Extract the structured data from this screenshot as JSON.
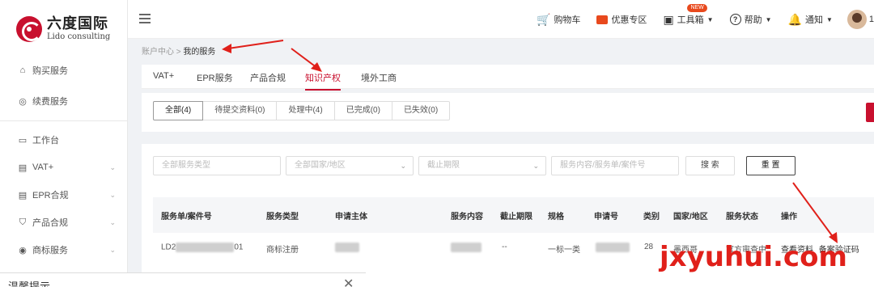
{
  "brand": {
    "name_cn": "六度国际",
    "name_en": "Lido consulting"
  },
  "sidebar": {
    "items": [
      {
        "icon": "shopping-bag-icon",
        "glyph": "⌂",
        "label": "购买服务",
        "chevron": false
      },
      {
        "icon": "renew-icon",
        "glyph": "◎",
        "label": "续费服务",
        "chevron": false
      },
      {
        "icon": "monitor-icon",
        "glyph": "▭",
        "label": "工作台",
        "chevron": false
      },
      {
        "icon": "vat-icon",
        "glyph": "▤",
        "label": "VAT+",
        "chevron": true
      },
      {
        "icon": "epr-icon",
        "glyph": "▤",
        "label": "EPR合规",
        "chevron": true
      },
      {
        "icon": "shield-icon",
        "glyph": "⛉",
        "label": "产品合规",
        "chevron": true
      },
      {
        "icon": "trademark-icon",
        "glyph": "◉",
        "label": "商标服务",
        "chevron": true
      }
    ]
  },
  "header": {
    "cart": "购物车",
    "coupon": "优惠专区",
    "toolbox": "工具箱",
    "toolbox_badge": "NEW",
    "help": "帮助",
    "notify": "通知",
    "user_initial": "1"
  },
  "breadcrumb": {
    "root": "账户中心",
    "sep": ">",
    "current": "我的服务"
  },
  "service_tabs": [
    "VAT+",
    "EPR服务",
    "产品合规",
    "知识产权",
    "境外工商"
  ],
  "active_tab": "知识产权",
  "status_filters": [
    "全部(4)",
    "待提交资料(0)",
    "处理中(4)",
    "已完成(0)",
    "已失效(0)"
  ],
  "search": {
    "service_type_placeholder": "全部服务类型",
    "country_placeholder": "全部国家/地区",
    "deadline_placeholder": "截止期限",
    "keyword_placeholder": "服务内容/服务单/案件号",
    "search_btn": "搜 索",
    "reset_btn": "重 置"
  },
  "table": {
    "headers": [
      "服务单/案件号",
      "服务类型",
      "申请主体",
      "服务内容",
      "截止期限",
      "规格",
      "申请号",
      "类别",
      "国家/地区",
      "服务状态",
      "操作"
    ],
    "row": {
      "order_prefix": "LD2",
      "order_suffix": "01",
      "service_type": "商标注册",
      "deadline": "--",
      "spec": "一标一类",
      "class": "28",
      "country": "墨西哥",
      "status": "官方审查中",
      "actions": [
        "查看资料",
        "备案验证码"
      ]
    }
  },
  "watermark": "jxyuhui.com",
  "dialog": {
    "title": "温馨提示"
  }
}
